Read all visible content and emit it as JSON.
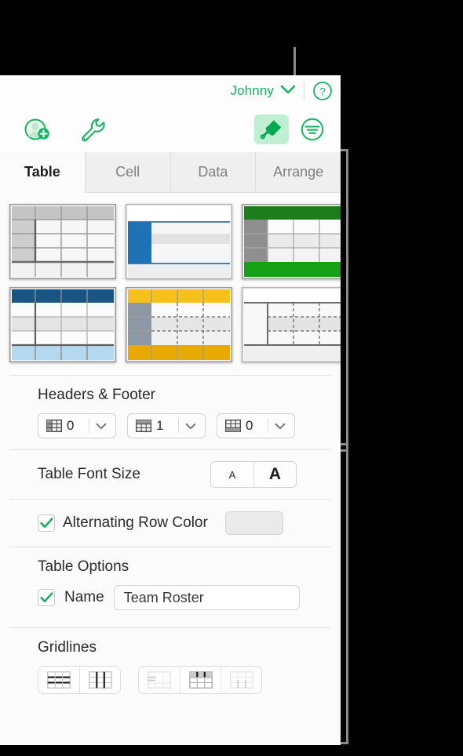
{
  "app": {
    "account_name": "Johnny",
    "accent_green": "#16b45f",
    "panel_bg": "#fbfbfb"
  },
  "topbar": {
    "account_label": "Johnny",
    "chevron_icon": "chevron-down-icon",
    "help_icon": "question-mark-circle-icon"
  },
  "toolbar": {
    "items": [
      {
        "name": "add-collaborator-icon",
        "label": "Collaborate"
      },
      {
        "name": "tools-wrench-icon",
        "label": "Tools"
      }
    ],
    "right_items": [
      {
        "name": "format-paintbrush-icon",
        "label": "Format",
        "active": true
      },
      {
        "name": "organize-filter-icon",
        "label": "Organize",
        "active": false
      }
    ]
  },
  "tabs": [
    {
      "label": "Table",
      "selected": true
    },
    {
      "label": "Cell",
      "selected": false
    },
    {
      "label": "Data",
      "selected": false
    },
    {
      "label": "Arrange",
      "selected": false
    }
  ],
  "table_styles": [
    {
      "name": "style-gray-basic",
      "header_color": "#b8b8b8",
      "accent": "#b8b8b8",
      "selected": false
    },
    {
      "name": "style-blue-sidebar",
      "header_color": "#ffffff",
      "accent": "#1f72b5",
      "selected": false
    },
    {
      "name": "style-green-banded",
      "header_color": "#1b7d1b",
      "accent": "#16a016",
      "selected": false
    },
    {
      "name": "style-navy-header",
      "header_color": "#1a5582",
      "accent": "#b4d8ef",
      "selected": false
    },
    {
      "name": "style-gold-dashed",
      "header_color": "#f5c21b",
      "accent": "#e8a900",
      "selected": false
    },
    {
      "name": "style-plain-dashed",
      "header_color": "#ffffff",
      "accent": "#cfcfcf",
      "selected": false
    }
  ],
  "headers_footer": {
    "title": "Headers & Footer",
    "controls": [
      {
        "name": "header-columns-popup",
        "icon": "header-column-icon",
        "value": "0"
      },
      {
        "name": "header-rows-popup",
        "icon": "header-row-icon",
        "value": "1"
      },
      {
        "name": "footer-rows-popup",
        "icon": "footer-row-icon",
        "value": "0"
      }
    ]
  },
  "font_size": {
    "label": "Table Font Size",
    "decrease_label": "A",
    "increase_label": "A"
  },
  "alternating_row": {
    "label": "Alternating Row Color",
    "checked": true,
    "swatch_color": "#eaeaea"
  },
  "table_options": {
    "title": "Table Options",
    "name_label": "Name",
    "name_checked": true,
    "name_value": "Team Roster"
  },
  "gridlines": {
    "title": "Gridlines",
    "group_one": [
      {
        "name": "gridline-horizontal-button",
        "icon": "grid-horizontal-icon",
        "enabled": true
      },
      {
        "name": "gridline-vertical-button",
        "icon": "grid-vertical-icon",
        "enabled": true
      }
    ],
    "group_two": [
      {
        "name": "gridline-header-horizontal-button",
        "icon": "grid-header-horizontal-icon",
        "enabled": false
      },
      {
        "name": "gridline-header-vertical-button",
        "icon": "grid-header-vertical-icon",
        "enabled": true
      },
      {
        "name": "gridline-footer-vertical-button",
        "icon": "grid-footer-vertical-icon",
        "enabled": false
      }
    ]
  }
}
